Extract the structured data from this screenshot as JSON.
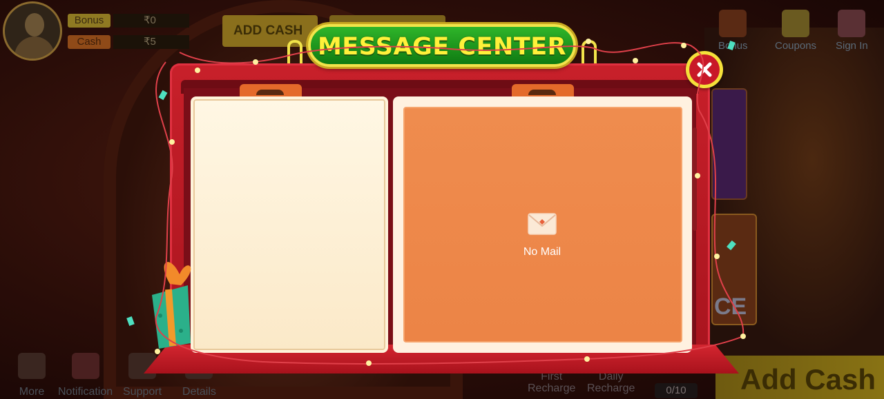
{
  "background": {
    "balances": [
      {
        "label": "Bonus",
        "value": "₹0"
      },
      {
        "label": "Cash",
        "value": "₹5"
      }
    ],
    "add_cash_top_label": "ADD CASH",
    "top_right_items": [
      {
        "label": "Bonus",
        "icon": "wallet-icon"
      },
      {
        "label": "Coupons",
        "icon": "coupon-icon"
      },
      {
        "label": "Sign In",
        "icon": "sign-in-icon"
      }
    ],
    "bottom_nav": [
      {
        "label": "More",
        "icon": "gear-icon"
      },
      {
        "label": "Notification",
        "icon": "mail-icon"
      },
      {
        "label": "Support",
        "icon": "headset-icon"
      },
      {
        "label": "Details",
        "icon": "clipboard-icon"
      }
    ],
    "recharge_items": [
      {
        "line1": "First",
        "line2": "Recharge"
      },
      {
        "line1": "Daily",
        "line2": "Recharge"
      }
    ],
    "counter": "0/10",
    "add_cash_big_label": "Add Cash",
    "card_text": "CE"
  },
  "modal": {
    "title": "MESSAGE CENTER",
    "empty_text": "No Mail",
    "icons": {
      "close": "close-icon",
      "envelope": "envelope-icon"
    },
    "colors": {
      "title_bg": "#1f9a1e",
      "title_text": "#fff13a",
      "frame": "#c8202a",
      "detail_bg": "#ee8a4c"
    }
  }
}
